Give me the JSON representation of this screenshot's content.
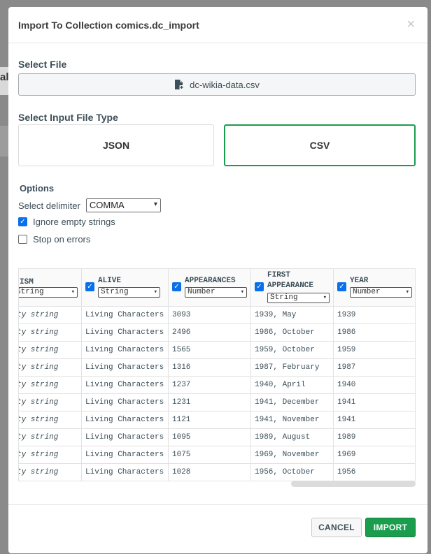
{
  "backdrop": {
    "fragment_text": "al"
  },
  "modal": {
    "title": "Import To Collection comics.dc_import",
    "close_glyph": "×",
    "select_file_label": "Select File",
    "file_name": "dc-wikia-data.csv",
    "file_icon": "file-add-icon",
    "select_type_label": "Select Input File Type",
    "types": [
      {
        "label": "JSON",
        "selected": false
      },
      {
        "label": "CSV",
        "selected": true
      }
    ],
    "options": {
      "label": "Options",
      "delimiter_label": "Select delimiter",
      "delimiter_value": "COMMA",
      "ignore_empty_label": "Ignore empty strings",
      "ignore_empty_checked": true,
      "stop_on_errors_label": "Stop on errors",
      "stop_on_errors_checked": false
    },
    "table": {
      "columns": [
        {
          "name": "ISM",
          "type": "String",
          "checked": true,
          "values": [
            "ty string",
            "ty string",
            "ty string",
            "ty string",
            "ty string",
            "ty string",
            "ty string",
            "ty string",
            "ty string",
            "ty string"
          ]
        },
        {
          "name": "ALIVE",
          "type": "String",
          "checked": true,
          "values": [
            "Living Characters",
            "Living Characters",
            "Living Characters",
            "Living Characters",
            "Living Characters",
            "Living Characters",
            "Living Characters",
            "Living Characters",
            "Living Characters",
            "Living Characters"
          ]
        },
        {
          "name": "APPEARANCES",
          "type": "Number",
          "checked": true,
          "values": [
            "3093",
            "2496",
            "1565",
            "1316",
            "1237",
            "1231",
            "1121",
            "1095",
            "1075",
            "1028"
          ]
        },
        {
          "name_line1": "FIRST",
          "name_line2": "APPEARANCE",
          "type": "String",
          "checked": true,
          "values": [
            "1939, May",
            "1986, October",
            "1959, October",
            "1987, February",
            "1940, April",
            "1941, December",
            "1941, November",
            "1989, August",
            "1969, November",
            "1956, October"
          ]
        },
        {
          "name": "YEAR",
          "type": "Number",
          "checked": true,
          "values": [
            "1939",
            "1986",
            "1959",
            "1987",
            "1940",
            "1941",
            "1941",
            "1989",
            "1969",
            "1956"
          ]
        }
      ]
    },
    "footer": {
      "cancel_label": "CANCEL",
      "import_label": "IMPORT"
    }
  },
  "colors": {
    "accent_green": "#1a9e4e",
    "checkbox_blue": "#0a6fe8"
  }
}
